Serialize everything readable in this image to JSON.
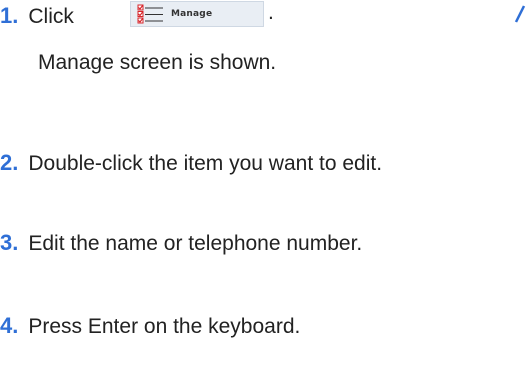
{
  "steps": [
    {
      "number": "1.",
      "text_before": "Click",
      "button_label": "Manage",
      "text_after": ".",
      "sub_text": "Manage screen is shown."
    },
    {
      "number": "2.",
      "text": "Double-click the item you want to edit."
    },
    {
      "number": "3.",
      "text": "Edit the name or telephone number."
    },
    {
      "number": "4.",
      "text": "Press Enter on the keyboard."
    }
  ],
  "colors": {
    "step_number": "#2f6fd6",
    "body_text": "#222222",
    "checkbox_red": "#d8262b"
  },
  "icons": {
    "manage_button": "checklist-icon"
  }
}
